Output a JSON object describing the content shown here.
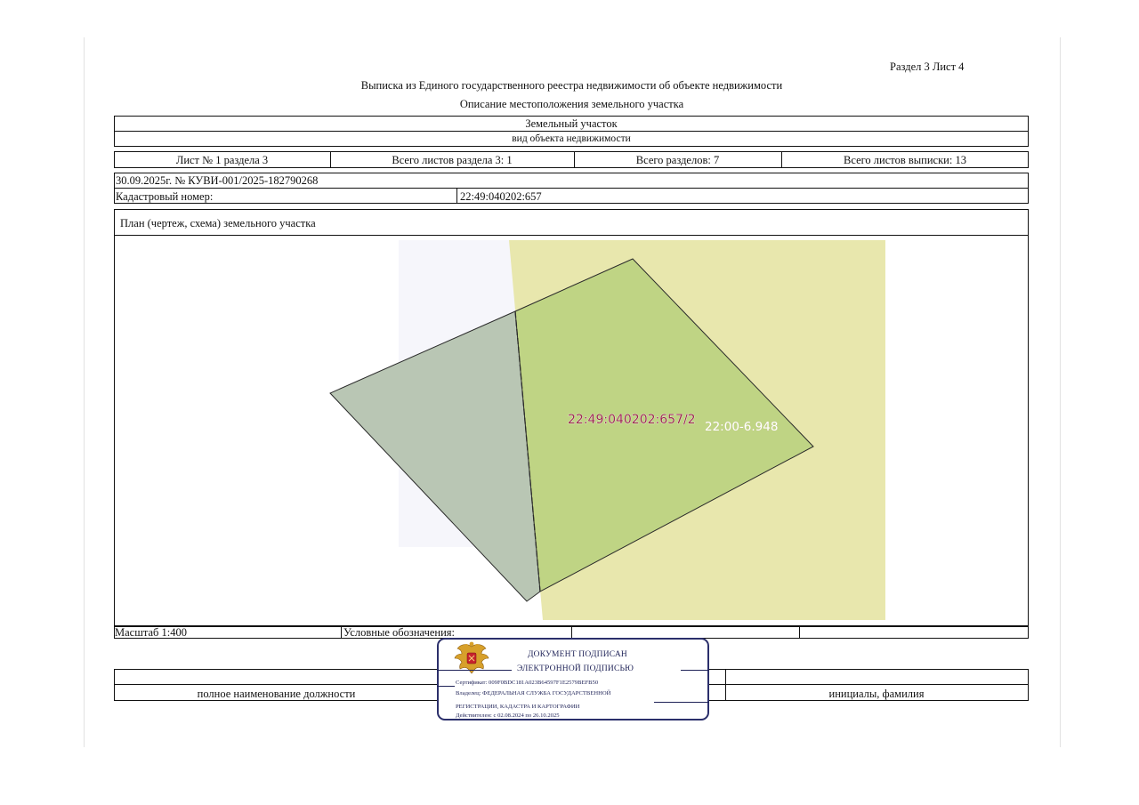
{
  "header": {
    "section_sheet": "Раздел 3   Лист 4",
    "title": "Выписка из Единого государственного реестра недвижимости об объекте недвижимости",
    "subtitle": "Описание местоположения земельного участка"
  },
  "object": {
    "type": "Земельный участок",
    "type_caption": "вид объекта недвижимости"
  },
  "sheet_info": {
    "sheet_no": "Лист № 1 раздела 3",
    "section_sheets": "Всего листов раздела 3: 1",
    "sections_total": "Всего разделов: 7",
    "extract_sheets": "Всего листов выписки: 13"
  },
  "record": {
    "date_number": "30.09.2025г. № КУВИ-001/2025-182790268",
    "cadastral_label": "Кадастровый номер:",
    "cadastral_value": "22:49:040202:657"
  },
  "plan": {
    "title": "План (чертеж, схема) земельного участка",
    "parcel_label": "22:49:040202:657/2",
    "zone_label": "22:00-6.948",
    "colors": {
      "zone_fill": "#e8e7ad",
      "parcel_fill": "#bfd484",
      "overlap_left_fill": "#b9c6b4",
      "label_color": "#9b2b4c"
    }
  },
  "footer": {
    "scale": "Масштаб 1:400",
    "legend": "Условные обозначения:",
    "position_caption": "полное наименование должности",
    "name_caption": "инициалы, фамилия"
  },
  "stamp": {
    "emblem_icon": "coat-of-arms-icon",
    "line1": "ДОКУМЕНТ ПОДПИСАН",
    "line2": "ЭЛЕКТРОННОЙ ПОДПИСЬЮ",
    "certificate": "Сертификат: 009F0BDC181A023B64597F1E2579BEFB50",
    "owner1": "Владелец: ФЕДЕРАЛЬНАЯ СЛУЖБА ГОСУДАРСТВЕННОЙ",
    "owner2": "РЕГИСТРАЦИИ, КАДАСТРА И КАРТОГРАФИИ",
    "valid": "Действителен: с 02.08.2024 по 26.10.2025"
  }
}
